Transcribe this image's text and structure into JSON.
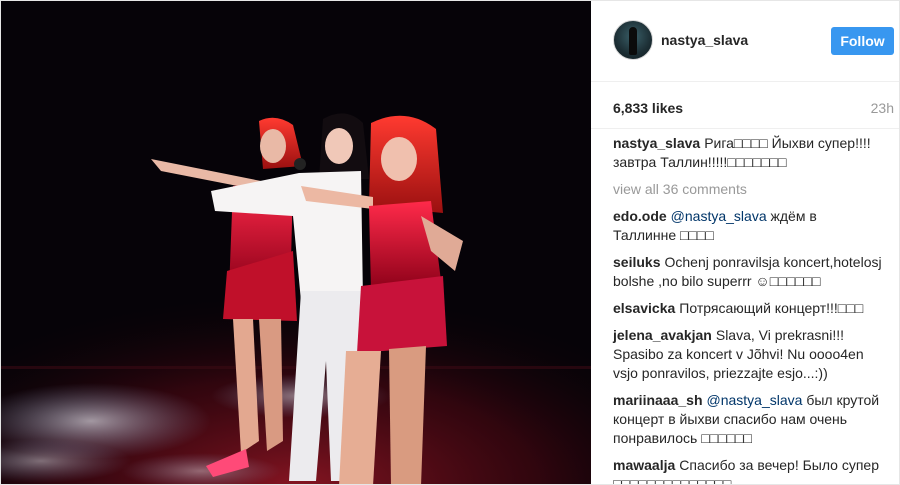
{
  "post": {
    "image_alt": "Concert photo: singer in white suit with two dancers in red sequined dresses on stage"
  },
  "header": {
    "username": "nastya_slava",
    "follow_label": "Follow"
  },
  "meta": {
    "likes": "6,833 likes",
    "time": "23h"
  },
  "caption": {
    "user": "nastya_slava",
    "text": "Рига□□□□ Йыхви супер!!!! завтра Таллин!!!!!□□□□□□□"
  },
  "view_all": "view all 36 comments",
  "comments": [
    {
      "user": "edo.ode",
      "mention": "@nastya_slava",
      "text": " ждём в Таллинне □□□□"
    },
    {
      "user": "seiluks",
      "mention": "",
      "text": "Ochenj ponravilsja koncert,hotelosj bolshe ,no bilo superrr ☺□□□□□□"
    },
    {
      "user": "elsavicka",
      "mention": "",
      "text": "Потрясающий концерт!!!□□□"
    },
    {
      "user": "jelena_avakjan",
      "mention": "",
      "text": "Slava, Vi prekrasni!!! Spasibo za koncert v Jõhvi! Nu oooo4en vsjo ponravilos, priezzajte esjo...:))"
    },
    {
      "user": "mariinaaa_sh",
      "mention": "@nastya_slava",
      "text": " был крутой концерт в йыхви спасибо нам очень понравилось □□□□□□"
    },
    {
      "user": "mawaalja",
      "mention": "",
      "text": "Спасибо за вечер! Было супер □□□□□□□□□□□□□□"
    }
  ]
}
